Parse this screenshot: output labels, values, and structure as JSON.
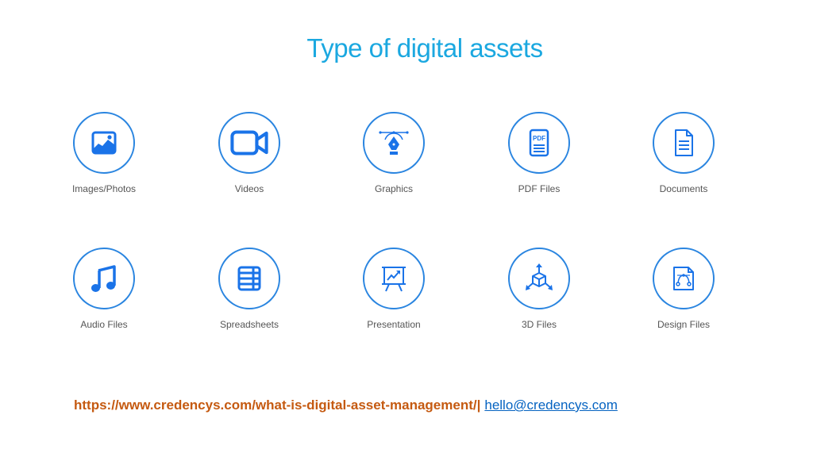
{
  "title": "Type of digital assets",
  "colors": {
    "title": "#1ba8e0",
    "icon": "#1a73e8",
    "circle": "#2a85e0",
    "label": "#555555",
    "url": "#c55a11",
    "email": "#0563c1"
  },
  "assets": [
    {
      "label": "Images/Photos",
      "icon": "image-icon"
    },
    {
      "label": "Videos",
      "icon": "video-camera-icon"
    },
    {
      "label": "Graphics",
      "icon": "pen-tool-icon"
    },
    {
      "label": "PDF Files",
      "icon": "pdf-file-icon"
    },
    {
      "label": "Documents",
      "icon": "document-icon"
    },
    {
      "label": "Audio Files",
      "icon": "music-note-icon"
    },
    {
      "label": "Spreadsheets",
      "icon": "table-grid-icon"
    },
    {
      "label": "Presentation",
      "icon": "presentation-board-icon"
    },
    {
      "label": "3D Files",
      "icon": "3d-cube-icon"
    },
    {
      "label": "Design Files",
      "icon": "design-file-icon"
    }
  ],
  "pdf_icon_text": "PDF",
  "footer": {
    "url": "https://www.credencys.com/what-is-digital-asset-management/",
    "separator": "|",
    "email": "hello@credencys.com"
  }
}
